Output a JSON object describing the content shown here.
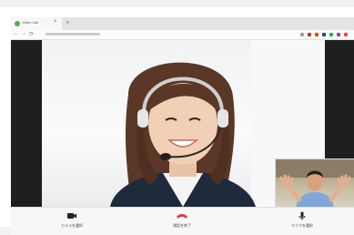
{
  "browser": {
    "tab_title": "Video Call",
    "tab_close": "×",
    "new_tab": "+",
    "nav": [
      "←",
      "→",
      "⟳"
    ]
  },
  "call": {
    "controls": [
      {
        "label": "カメラを選択",
        "icon": "camera-icon"
      },
      {
        "label": "通話を終了",
        "icon": "phone-hangup-icon",
        "color": "#e53935"
      },
      {
        "label": "マイクを選択",
        "icon": "microphone-icon"
      }
    ]
  },
  "colors": {
    "stage_background": "#1d1e20",
    "hangup": "#e53935",
    "favicon": "#4fae5c"
  }
}
